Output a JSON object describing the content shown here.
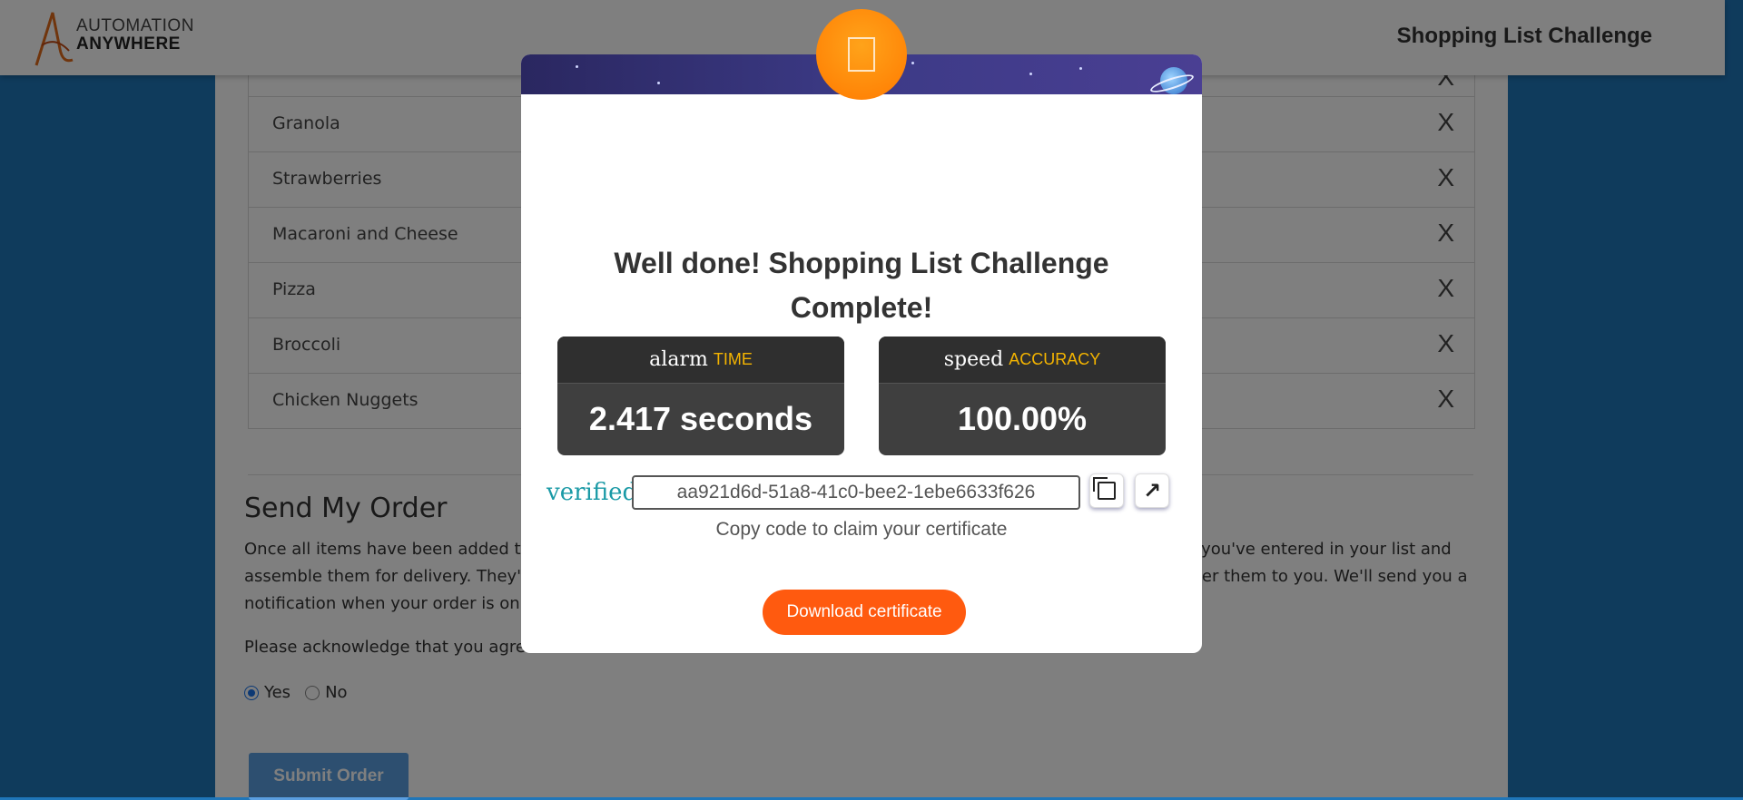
{
  "header": {
    "logo_line1": "AUTOMATION",
    "logo_line2": "ANYWHERE",
    "title": "Shopping List Challenge"
  },
  "list": {
    "items": [
      {
        "name": "",
        "remove": "X"
      },
      {
        "name": "Granola",
        "remove": "X"
      },
      {
        "name": "Strawberries",
        "remove": "X"
      },
      {
        "name": "Macaroni and Cheese",
        "remove": "X"
      },
      {
        "name": "Pizza",
        "remove": "X"
      },
      {
        "name": "Broccoli",
        "remove": "X"
      },
      {
        "name": "Chicken Nuggets",
        "remove": "X"
      }
    ]
  },
  "order": {
    "title": "Send My Order",
    "description": "Once all items have been added to your list, click the Submit Order button below. Our shoppers will go find all items you've entered in your list and assemble them for delivery. They'll hand your items to our courier agent who will drive them to your house and deliver them to you. We'll send you a notification when your order is on its way with your starter.",
    "acknowledge": "Please acknowledge that you agree to the terms above.",
    "option_yes": "Yes",
    "option_no": "No",
    "submit_label": "Submit Order"
  },
  "modal": {
    "title": "Well done! Shopping List Challenge Complete!",
    "time": {
      "icon": "alarm",
      "label": "TIME",
      "value": "2.417 seconds"
    },
    "accuracy": {
      "icon": "speed",
      "label": "ACCURACY",
      "value": "100.00%"
    },
    "verified_label": "verified",
    "code": "aa921d6d-51a8-41c0-bee2-1ebe6633f626",
    "copy_hint": "Copy code to claim your certificate",
    "download_label": "Download certificate"
  },
  "colors": {
    "page_bg": "#1f76b9",
    "accent_orange": "#ff5a0f",
    "badge_orange": "#ff8c00",
    "stat_label": "#f4b400",
    "verified_teal": "#1b9aa6",
    "submit_blue": "#5a9ee0"
  },
  "icons": {
    "badge": "trophy-icon",
    "copy": "copy-icon",
    "open": "external-link-icon",
    "planet": "planet-icon"
  }
}
